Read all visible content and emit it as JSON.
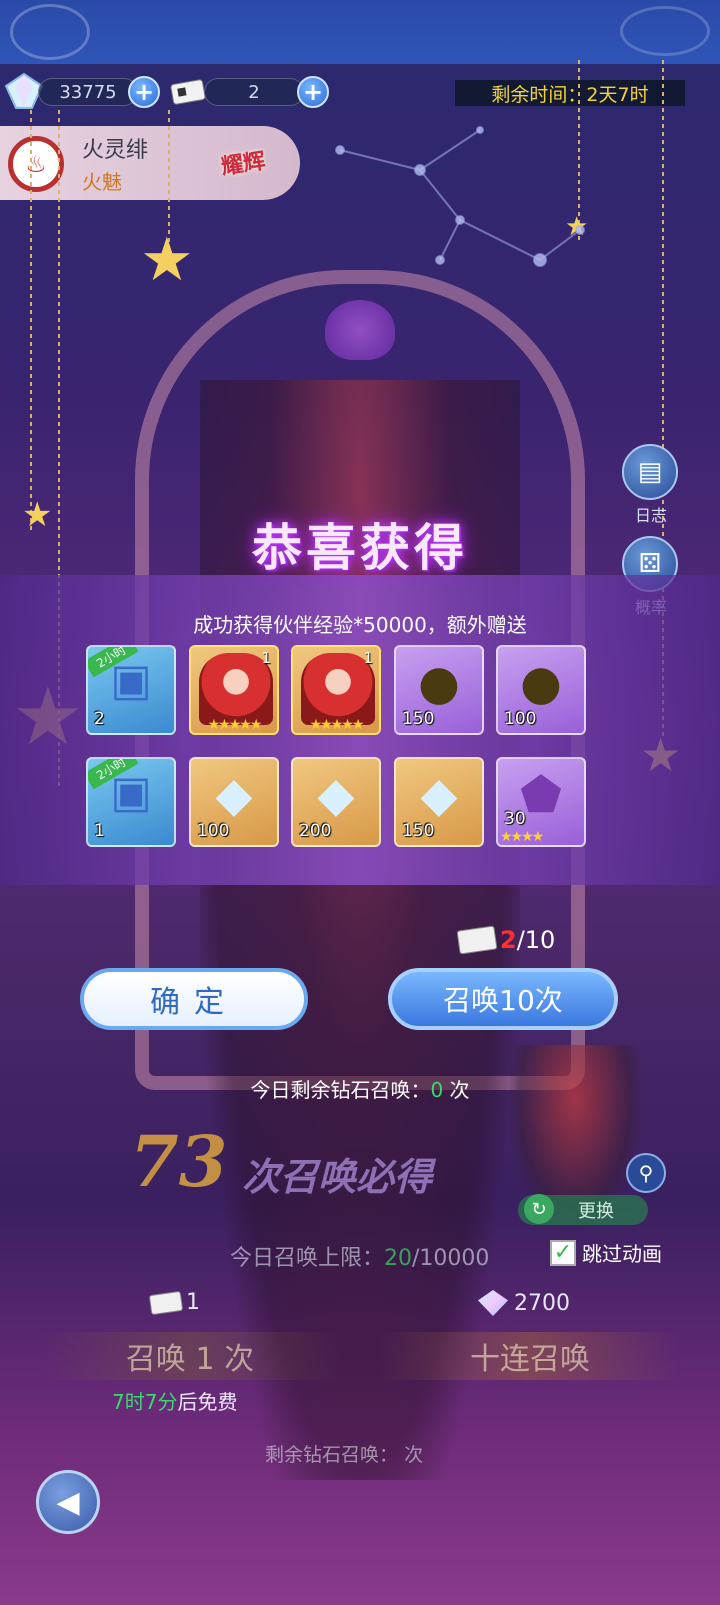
{
  "resources": {
    "diamonds": "33775",
    "tickets": "2",
    "plus_symbol": "+"
  },
  "timer": "剩余时间：2天7时",
  "hero": {
    "name": "火灵绯",
    "title": "火魅",
    "rank_tag": "耀辉"
  },
  "side_menu": {
    "log_label": "日志",
    "prob_label": "概率"
  },
  "reward_popup": {
    "title": "恭喜获得",
    "message": "成功获得伙伴经验*50000，额外赠送",
    "row1": [
      {
        "type": "chest",
        "badge": "2小时",
        "qty": "2",
        "color": "blue"
      },
      {
        "type": "hero",
        "num": "1",
        "stars": "★★★★★",
        "color": "gold"
      },
      {
        "type": "hero",
        "num": "1",
        "stars": "★★★★★",
        "color": "gold"
      },
      {
        "type": "ore",
        "qty": "150",
        "color": "purple"
      },
      {
        "type": "ore",
        "qty": "100",
        "color": "purple"
      }
    ],
    "row2": [
      {
        "type": "chest",
        "badge": "2小时",
        "qty": "1",
        "color": "blue"
      },
      {
        "type": "diamond",
        "qty": "100",
        "color": "gold"
      },
      {
        "type": "diamond",
        "qty": "200",
        "color": "gold"
      },
      {
        "type": "diamond",
        "qty": "150",
        "color": "gold"
      },
      {
        "type": "shard",
        "qty": "30",
        "stars": "★★★★",
        "color": "purple"
      }
    ]
  },
  "ticket_progress": {
    "current": "2",
    "total": "/10"
  },
  "buttons": {
    "confirm": "确定",
    "summon10": "召唤10次"
  },
  "daily_diamond": {
    "prefix": "今日剩余钻石召唤：",
    "count": "0",
    "suffix": "次"
  },
  "guarantee": {
    "number": "73",
    "text": "次召唤必得"
  },
  "change_label": "更换",
  "summon_limit": {
    "prefix": "今日召唤上限：",
    "current": "20",
    "total": "/10000"
  },
  "skip_animation": "跳过动画",
  "cost": {
    "single_tickets": "1",
    "ten_diamonds": "2700"
  },
  "summon_single": "召唤 1 次",
  "summon_ten": "十连召唤",
  "free_timer": {
    "time": "7时7分",
    "suffix": "后免费"
  },
  "remaining_diamond_summon": "剩余钻石召唤：",
  "remaining_suffix": "次"
}
